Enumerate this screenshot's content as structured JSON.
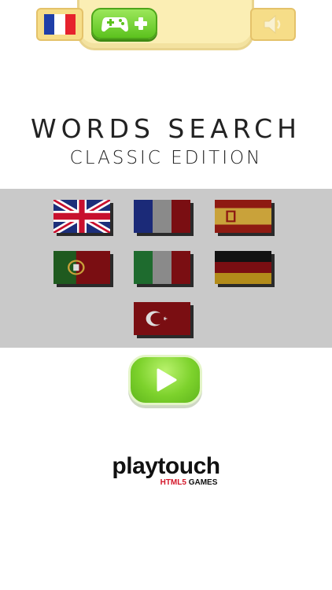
{
  "header": {
    "current_language_flag": "france-flag-icon",
    "more_games_icon": "gamepad-plus-icon",
    "sound_icon": "speaker-icon"
  },
  "title": {
    "main": "WORDS SEARCH",
    "sub": "CLASSIC EDITION"
  },
  "languages": [
    {
      "name": "english",
      "icon": "uk-flag-icon"
    },
    {
      "name": "french",
      "icon": "france-flag-icon"
    },
    {
      "name": "spanish",
      "icon": "spain-flag-icon"
    },
    {
      "name": "portuguese",
      "icon": "portugal-flag-icon"
    },
    {
      "name": "italian",
      "icon": "italy-flag-icon"
    },
    {
      "name": "german",
      "icon": "germany-flag-icon"
    },
    {
      "name": "turkish",
      "icon": "turkey-flag-icon"
    }
  ],
  "play_button": {
    "icon": "play-icon"
  },
  "logo": {
    "brand": "playtouch",
    "sub_prefix": "HTML5",
    "sub_suffix": " GAMES"
  },
  "colors": {
    "accent_green": "#7dd22c",
    "panel_gray": "#c9c9c9",
    "top_panel": "#fbeeb4"
  }
}
